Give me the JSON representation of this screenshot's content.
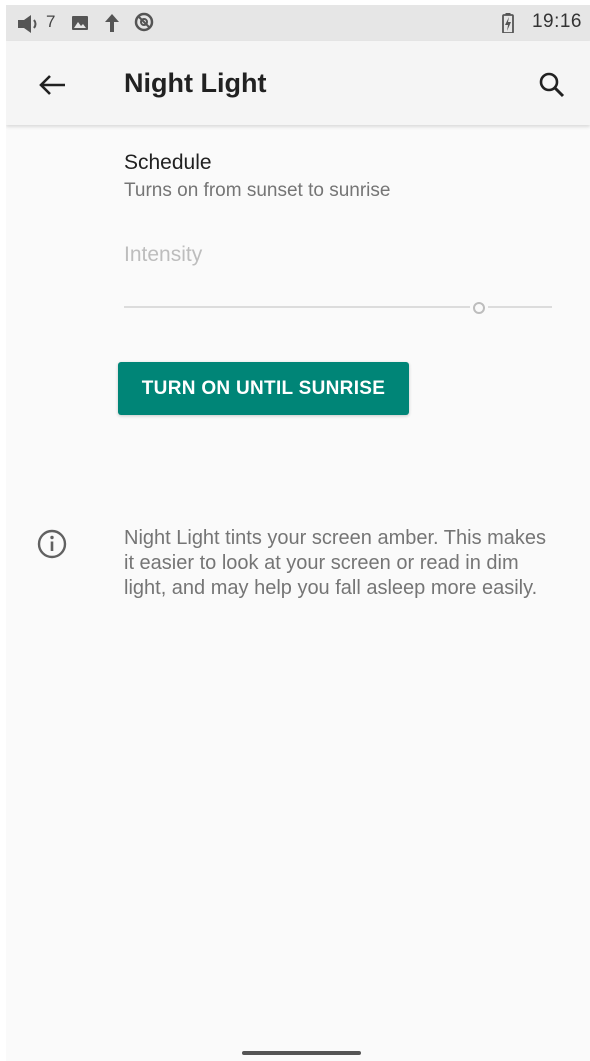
{
  "status_bar": {
    "volume_level": "7",
    "time": "19:16",
    "icons": [
      "volume-icon",
      "image-icon",
      "upload-icon",
      "data-saver-icon",
      "battery-charging-icon"
    ]
  },
  "toolbar": {
    "title": "Night Light",
    "back_icon": "arrow-back-icon",
    "search_icon": "search-icon"
  },
  "schedule": {
    "title": "Schedule",
    "summary": "Turns on from sunset to sunrise"
  },
  "intensity": {
    "label": "Intensity",
    "value_fraction": 0.83,
    "enabled": false
  },
  "action_button": {
    "label": "TURN ON UNTIL SUNRISE"
  },
  "footer": {
    "info_icon": "info-icon",
    "text": "Night Light tints your screen amber. This makes it easier to look at your screen or read in dim light, and may help you fall asleep more easily."
  },
  "colors": {
    "accent": "#008577",
    "background": "#fafafa",
    "status_bar": "#e6e6e6"
  }
}
